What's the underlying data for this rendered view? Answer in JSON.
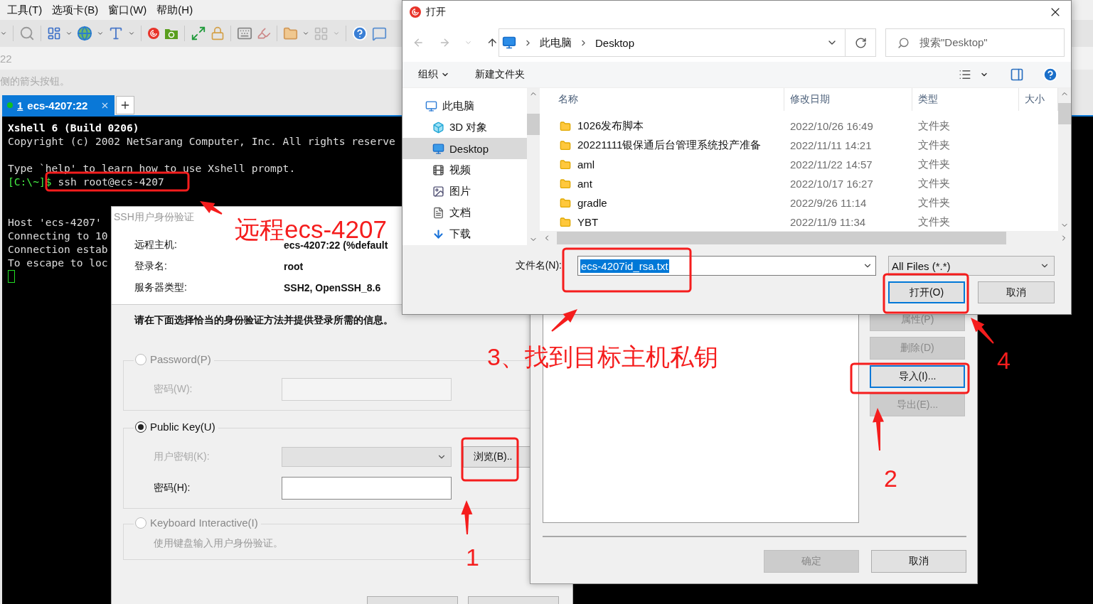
{
  "menu": [
    {
      "label": "工具(T)"
    },
    {
      "label": "选项卡(B)"
    },
    {
      "label": "窗口(W)"
    },
    {
      "label": "帮助(H)"
    }
  ],
  "address": "22",
  "hint": "侧的箭头按钮。",
  "tabs": [
    {
      "number": "1",
      "label": "ecs-4207:22",
      "selected": true
    }
  ],
  "terminal": {
    "lines": [
      {
        "kind": "bold",
        "text": "Xshell 6 (Build 0206)"
      },
      {
        "kind": "plain",
        "text": "Copyright (c) 2002 NetSarang Computer, Inc. All rights reserve"
      },
      {
        "kind": "blank"
      },
      {
        "kind": "plain",
        "text": "Type `help' to learn how to use Xshell prompt."
      },
      {
        "kind": "prompt",
        "prompt": "[C:\\~]$",
        "text": "ssh root@ecs-4207"
      },
      {
        "kind": "blank"
      },
      {
        "kind": "blank"
      },
      {
        "kind": "plain",
        "text": "Host 'ecs-4207'"
      },
      {
        "kind": "plain",
        "text": "Connecting to 10"
      },
      {
        "kind": "plain",
        "text": "Connection estab"
      },
      {
        "kind": "plain",
        "text": "To escape to loc"
      },
      {
        "kind": "cursor"
      }
    ]
  },
  "ssh_dialog": {
    "title": "SSH用户身份验证",
    "info": [
      {
        "label": "远程主机:",
        "value": "ecs-4207:22 (%default"
      },
      {
        "label": "登录名:",
        "value": "root"
      },
      {
        "label": "服务器类型:",
        "value": "SSH2, OpenSSH_8.6"
      }
    ],
    "instruction": "请在下面选择恰当的身份验证方法并提供登录所需的信息。",
    "methods": [
      {
        "label": "Password(P)",
        "selected": false,
        "disabled": true,
        "fields": [
          {
            "kind": "input",
            "label": "密码(W):",
            "disabled": true
          }
        ]
      },
      {
        "label": "Public Key(U)",
        "selected": true,
        "disabled": false,
        "fields": [
          {
            "kind": "select",
            "label": "用户密钥(K):",
            "disabled": true,
            "button": "浏览(B).."
          },
          {
            "kind": "input",
            "label": "密码(H):",
            "disabled": false
          }
        ]
      },
      {
        "label": "Keyboard Interactive(I)",
        "selected": false,
        "disabled": true,
        "description": "使用键盘输入用户身份验证。"
      }
    ]
  },
  "key_dialog": {
    "side_buttons": [
      {
        "label": "属性(P)",
        "disabled": true,
        "focused": false
      },
      {
        "label": "删除(D)",
        "disabled": true,
        "focused": false
      },
      {
        "label": "导入(I)...",
        "disabled": false,
        "focused": true
      },
      {
        "label": "导出(E)...",
        "disabled": true,
        "focused": false
      }
    ],
    "buttons": [
      {
        "label": "确定",
        "disabled": true
      },
      {
        "label": "取消",
        "disabled": false
      }
    ]
  },
  "open_dialog": {
    "title": "打开",
    "path": [
      "此电脑",
      "Desktop"
    ],
    "search_placeholder": "搜索\"Desktop\"",
    "toolbar": [
      {
        "label": "组织",
        "menu": true
      },
      {
        "label": "新建文件夹",
        "menu": false
      }
    ],
    "nav": [
      {
        "label": "此电脑",
        "kind": "pc",
        "selected": false,
        "children": [
          {
            "label": "3D 对象",
            "kind": "objects",
            "selected": false
          },
          {
            "label": "Desktop",
            "kind": "desktop",
            "selected": true
          },
          {
            "label": "视频",
            "kind": "video",
            "selected": false
          },
          {
            "label": "图片",
            "kind": "pictures",
            "selected": false
          },
          {
            "label": "文档",
            "kind": "documents",
            "selected": false
          },
          {
            "label": "下载",
            "kind": "downloads",
            "selected": false
          }
        ]
      }
    ],
    "columns": [
      "名称",
      "修改日期",
      "类型",
      "大小"
    ],
    "files": [
      {
        "name": "1026发布脚本",
        "modified": "2022/10/26 16:49",
        "type": "文件夹"
      },
      {
        "name": "20221111银保通后台管理系统投产准备",
        "modified": "2022/11/11 14:21",
        "type": "文件夹"
      },
      {
        "name": "aml",
        "modified": "2022/11/22 14:57",
        "type": "文件夹"
      },
      {
        "name": "ant",
        "modified": "2022/10/17 16:27",
        "type": "文件夹"
      },
      {
        "name": "gradle",
        "modified": "2022/9/26 11:14",
        "type": "文件夹"
      },
      {
        "name": "YBT",
        "modified": "2022/11/9 11:34",
        "type": "文件夹"
      }
    ],
    "filename_label": "文件名(N):",
    "filename": "ecs-4207id_rsa.txt",
    "filter": "All Files (*.*)",
    "buttons": [
      {
        "label": "打开(O)",
        "default": true
      },
      {
        "label": "取消",
        "default": false
      }
    ]
  },
  "annotations": {
    "remote": "远程ecs-4207",
    "step3": "3、找到目标主机私钥",
    "step1": "1",
    "step2": "2",
    "step4": "4"
  }
}
